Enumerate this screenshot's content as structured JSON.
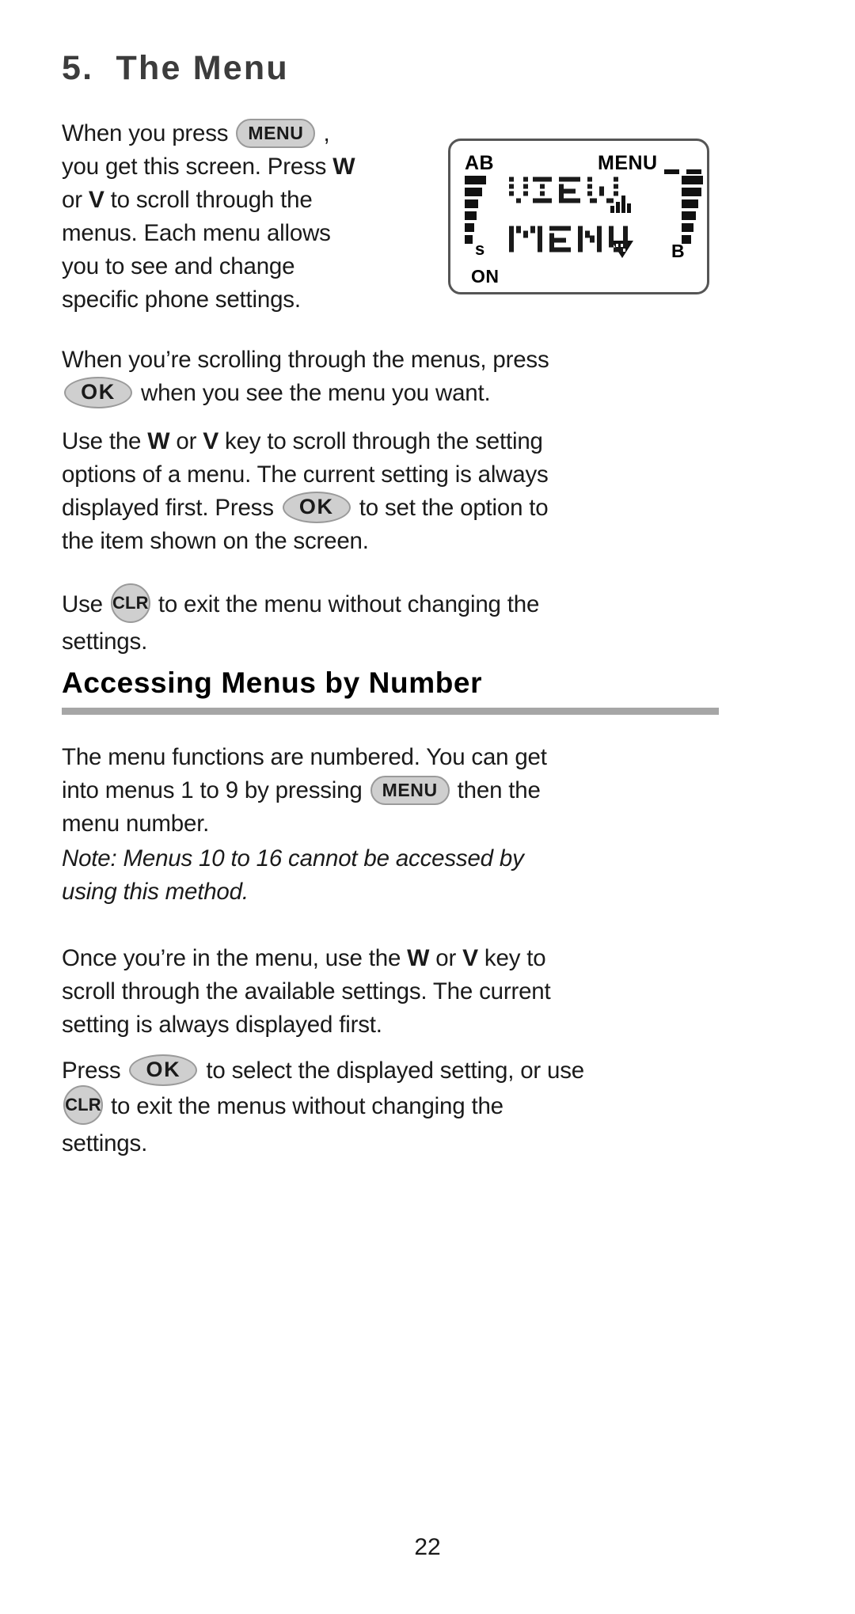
{
  "document": {
    "chapter_title": "5.  The Menu",
    "page_number": "22"
  },
  "keys": {
    "menu": "MENU",
    "ok": "OK",
    "clr": "CLR",
    "up_arrow": "W",
    "down_arrow": "V"
  },
  "paragraphs": {
    "intro_1": "When you press ",
    "intro_2": " , you get this screen. Press ",
    "intro_3": " or ",
    "intro_4": " to scroll through the menus. Each menu allows you to see and change specific phone settings.",
    "scrolling_1": "When you’re scrolling through the menus, press ",
    "scrolling_2": " when you see the menu you want.",
    "use_key_1": "Use the ",
    "use_key_2": " or ",
    "use_key_3": " key to scroll through the setting options of a menu. The current setting is always displayed first. Press ",
    "use_key_4": " to set the option to the item shown on the screen.",
    "exit_1": "Use ",
    "exit_2": " to exit the menu without changing the settings."
  },
  "section": {
    "heading": "Accessing Menus by Number",
    "numbered_1": "The menu functions are numbered. You can get into menus 1 to 9 by pressing ",
    "numbered_2": " then the menu number.",
    "note": "Note: Menus 10 to 16 cannot be accessed by using this method.",
    "once_1": "Once you’re in the menu, use the  ",
    "once_2": " or ",
    "once_3": "  key to scroll through the available settings. The current setting is always displayed first.",
    "press_1": "Press ",
    "press_2": " to select the displayed setting, or use ",
    "press_3": " to exit the menus without changing the settings."
  },
  "lcd": {
    "indicator_ab": "AB",
    "indicator_menu": "MENU",
    "indicator_s": "s",
    "indicator_on": "ON",
    "indicator_b": "B",
    "line_1": "VIEW",
    "line_2": "MENU"
  },
  "colors": {
    "key_fill": "#cfcfcf",
    "key_border": "#9a9a9a",
    "heading_rule": "#a6a6a6",
    "title_gray": "#3c3c3c",
    "text": "#1a1a1a"
  }
}
